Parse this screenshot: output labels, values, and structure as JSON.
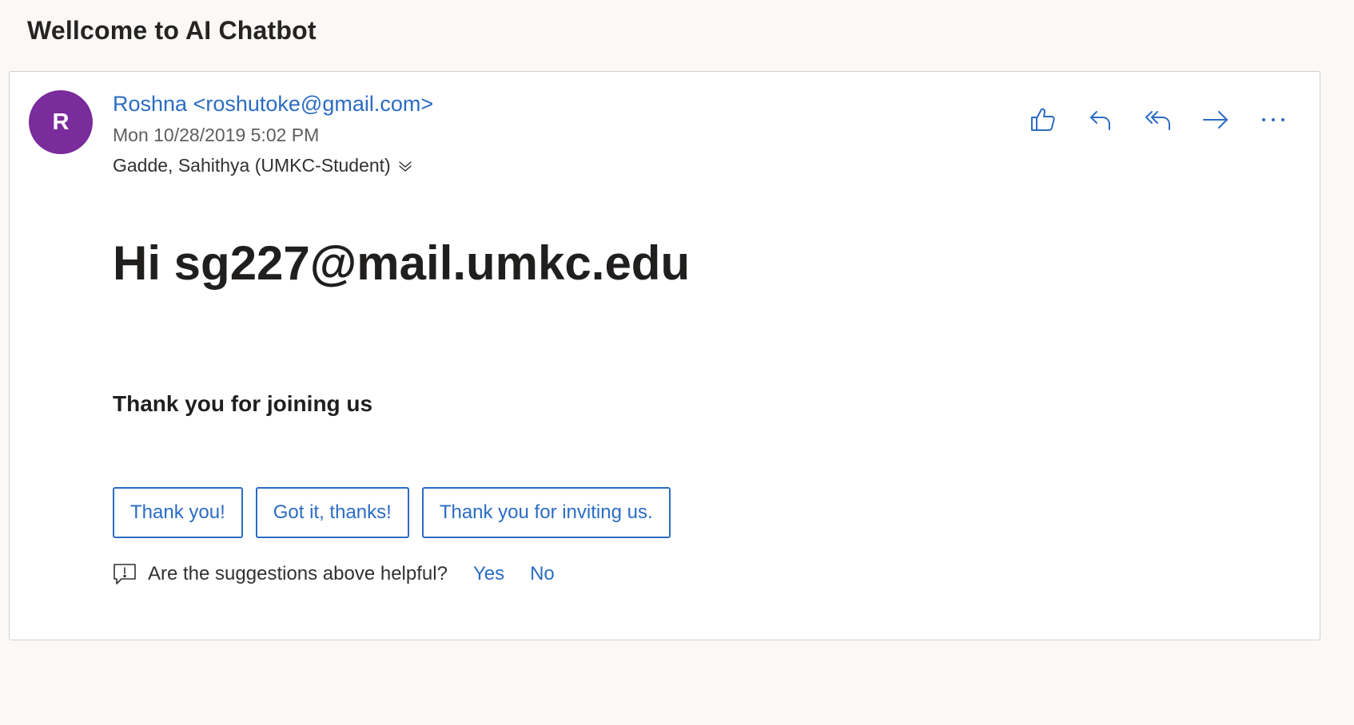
{
  "message": {
    "subject": "Wellcome to AI Chatbot",
    "avatar_initial": "R",
    "sender": "Roshna <roshutoke@gmail.com>",
    "datetime": "Mon 10/28/2019 5:02 PM",
    "recipient": "Gadde, Sahithya (UMKC-Student)",
    "greeting": "Hi sg227@mail.umkc.edu",
    "body": "Thank you for joining us"
  },
  "actions": [
    {
      "icon": "like-icon"
    },
    {
      "icon": "reply-icon"
    },
    {
      "icon": "reply-all-icon"
    },
    {
      "icon": "forward-icon"
    },
    {
      "icon": "more-icon"
    }
  ],
  "suggested_replies": [
    "Thank you!",
    "Got it, thanks!",
    "Thank you for inviting us."
  ],
  "feedback": {
    "question": "Are the suggestions above helpful?",
    "yes_label": "Yes",
    "no_label": "No"
  },
  "colors": {
    "accent": "#2b6cc4",
    "avatar_bg": "#7a2b9c",
    "page_bg": "#faf9f8",
    "card_border": "#d2d0ce"
  }
}
